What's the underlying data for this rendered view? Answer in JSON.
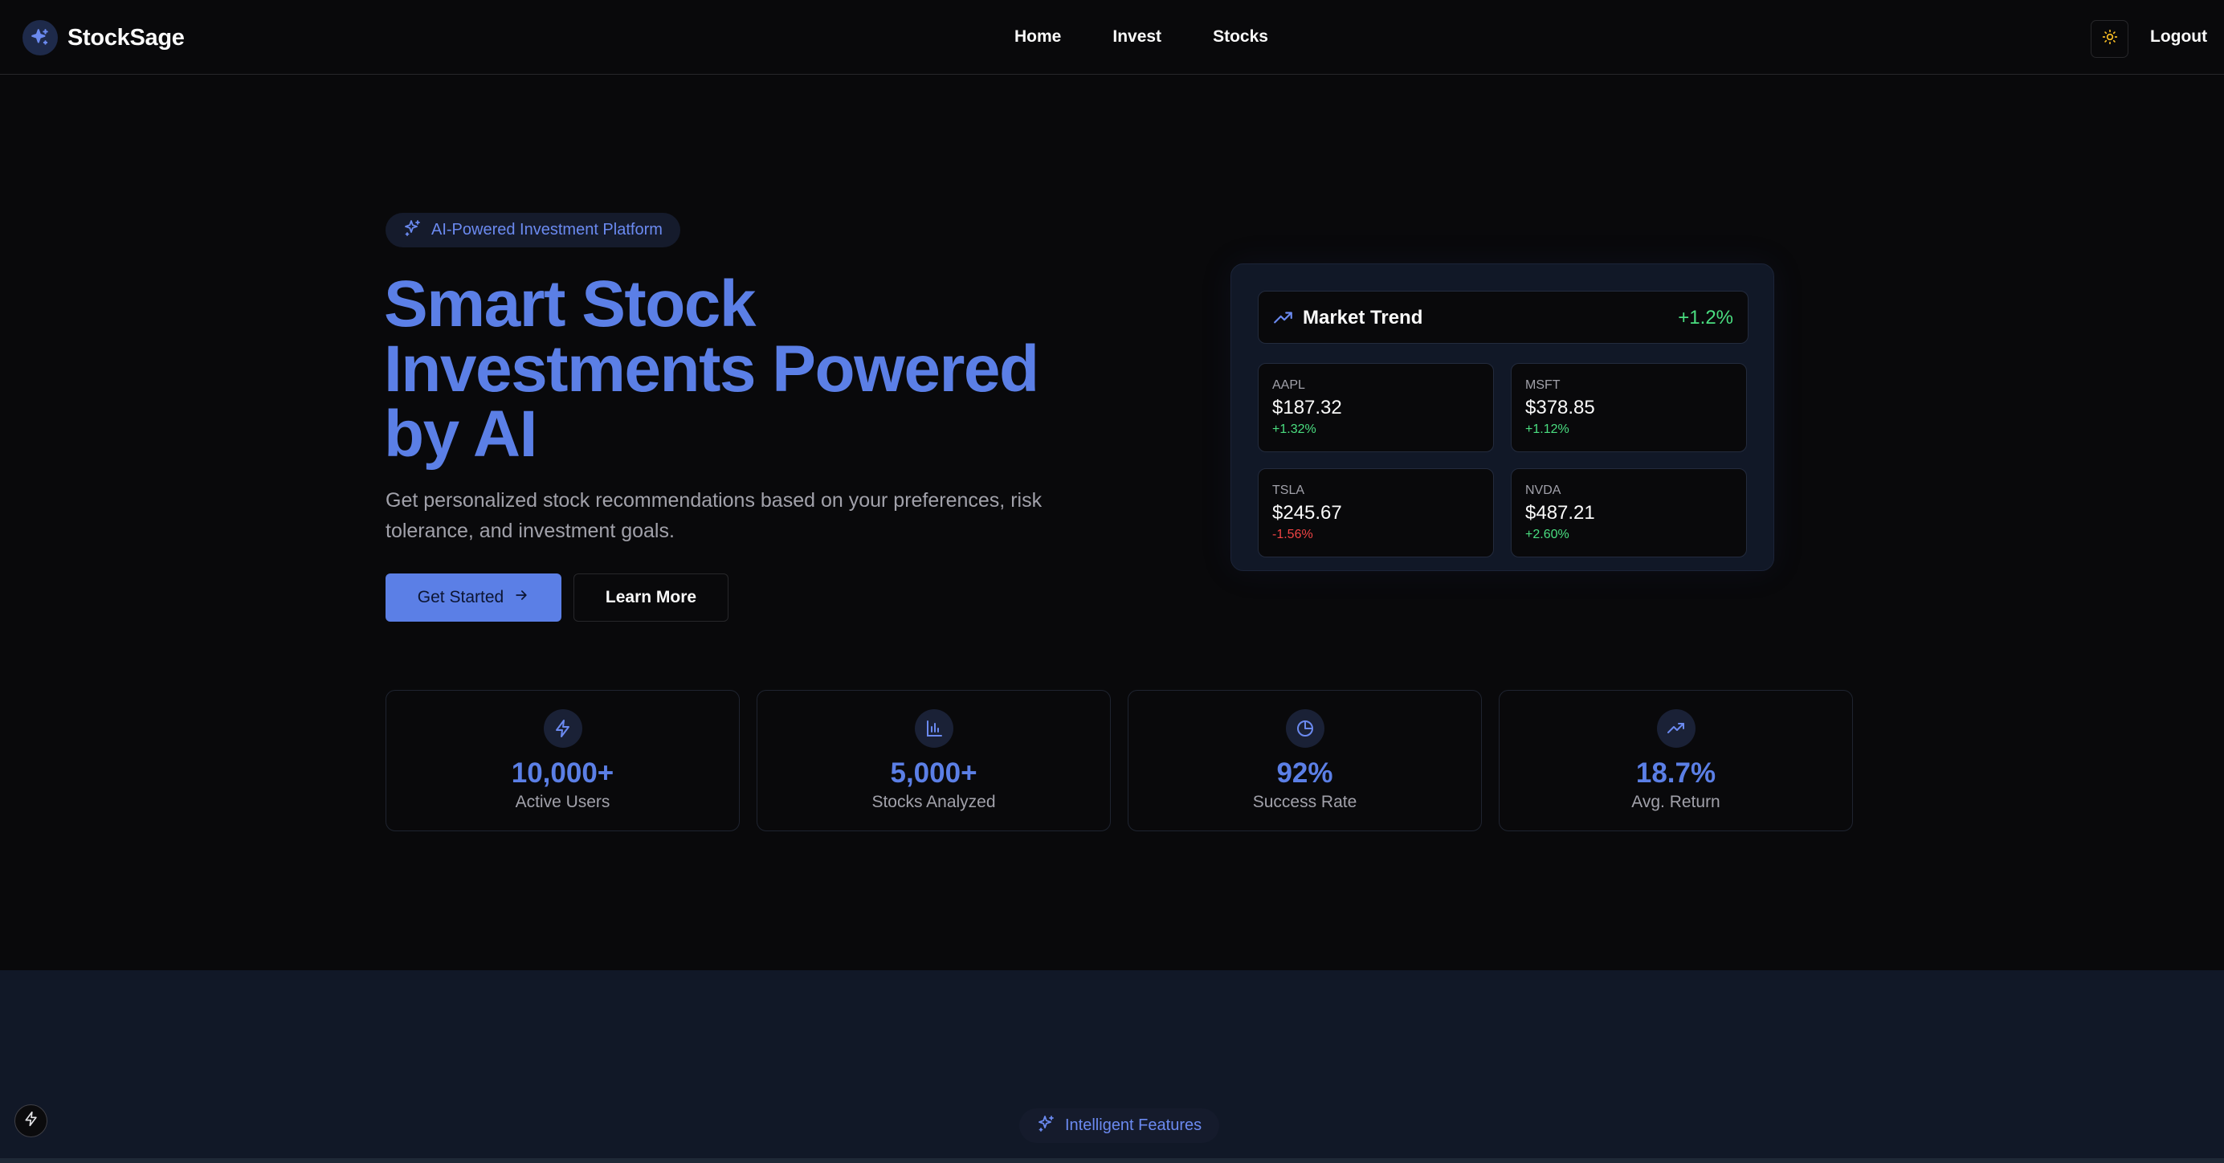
{
  "brand": {
    "name": "StockSage",
    "logo_icon": "sparkles-icon"
  },
  "nav": {
    "home": "Home",
    "invest": "Invest",
    "stocks": "Stocks"
  },
  "header": {
    "theme_toggle_icon": "sun-icon",
    "logout": "Logout"
  },
  "hero": {
    "badge": "AI-Powered Investment Platform",
    "title_lines": [
      "Smart Stock",
      "Investments Powered",
      "by AI"
    ],
    "subtitle": "Get personalized stock recommendations based on your preferences, risk tolerance, and investment goals.",
    "primary_button": "Get Started",
    "secondary_button": "Learn More"
  },
  "market": {
    "title": "Market Trend",
    "change": "+1.2%",
    "tickers": [
      {
        "symbol": "AAPL",
        "price": "$187.32",
        "change": "+1.32%",
        "direction": "up"
      },
      {
        "symbol": "MSFT",
        "price": "$378.85",
        "change": "+1.12%",
        "direction": "up"
      },
      {
        "symbol": "TSLA",
        "price": "$245.67",
        "change": "-1.56%",
        "direction": "down"
      },
      {
        "symbol": "NVDA",
        "price": "$487.21",
        "change": "+2.60%",
        "direction": "up"
      }
    ]
  },
  "stats": [
    {
      "icon": "lightning-icon",
      "value": "10,000+",
      "label": "Active Users"
    },
    {
      "icon": "bar-chart-icon",
      "value": "5,000+",
      "label": "Stocks Analyzed"
    },
    {
      "icon": "pie-chart-icon",
      "value": "92%",
      "label": "Success Rate"
    },
    {
      "icon": "trending-up-icon",
      "value": "18.7%",
      "label": "Avg. Return"
    }
  ],
  "features": {
    "badge": "Intelligent Features"
  },
  "colors": {
    "accent": "#5b7fe6",
    "positive": "#4ade80",
    "negative": "#ef4444",
    "background": "#09090b",
    "muted_text": "#a1a1aa"
  }
}
